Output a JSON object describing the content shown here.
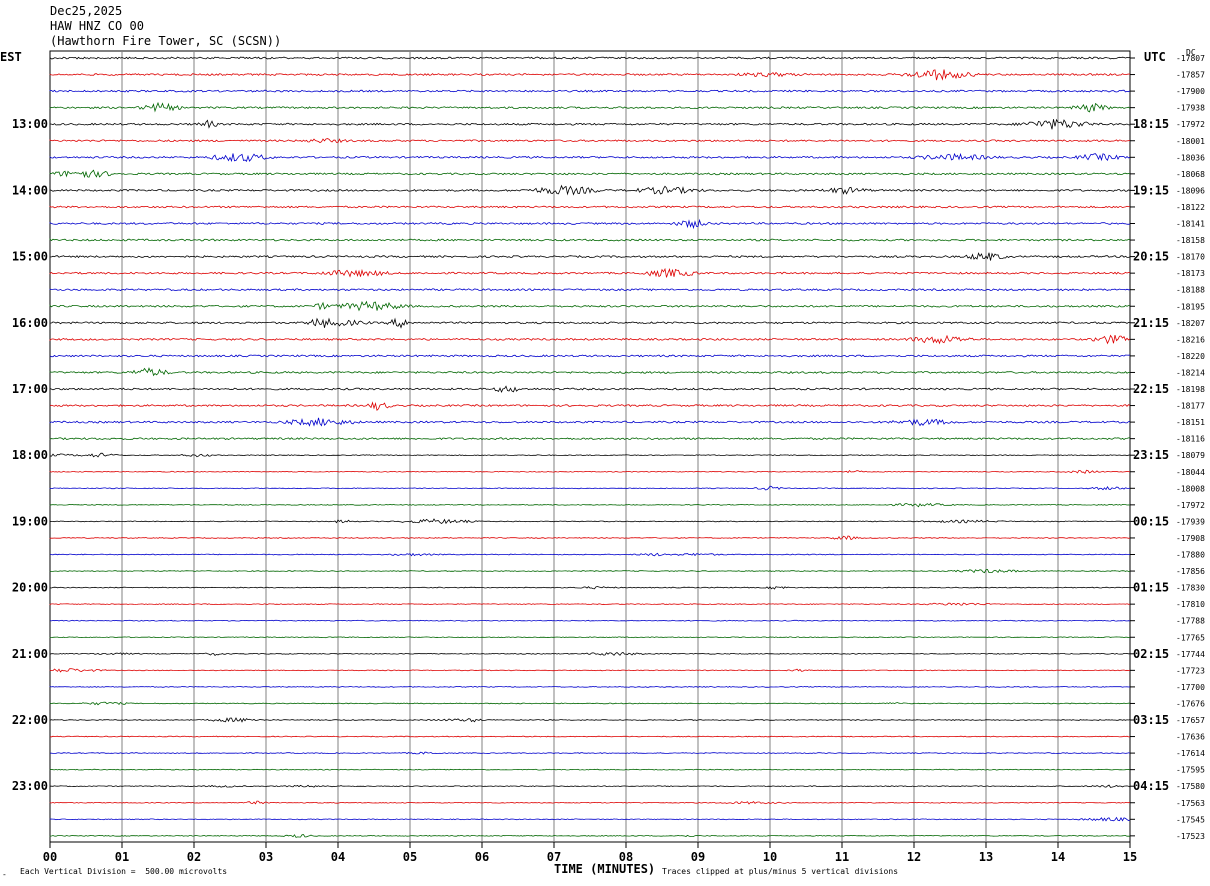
{
  "header": {
    "date": "Dec25,2025",
    "station": "HAW HNZ CO 00",
    "location": "(Hawthorn Fire Tower, SC (SCSN))"
  },
  "left_tz": "EST",
  "right_tz": "UTC",
  "right_unit": "DC",
  "chart_data": {
    "type": "line",
    "title": "",
    "xlabel": "TIME (MINUTES)",
    "x_ticks": [
      "00",
      "01",
      "02",
      "03",
      "04",
      "05",
      "06",
      "07",
      "08",
      "09",
      "10",
      "11",
      "12",
      "13",
      "14",
      "15"
    ],
    "xlim": [
      0,
      15
    ],
    "trace_colors": [
      "#000000",
      "#dd0000",
      "#0000cc",
      "#006600"
    ],
    "left_time_labels": [
      "13:00",
      "14:00",
      "15:00",
      "16:00",
      "17:00",
      "18:00",
      "19:00",
      "20:00",
      "21:00",
      "22:00",
      "23:00"
    ],
    "right_time_labels": [
      "18:15",
      "19:15",
      "20:15",
      "21:15",
      "22:15",
      "23:15",
      "00:15",
      "01:15",
      "02:15",
      "03:15",
      "04:15"
    ],
    "dc_offsets": [
      "-17807",
      "-17857",
      "-17900",
      "-17938",
      "-17972",
      "-18001",
      "-18036",
      "-18068",
      "-18096",
      "-18122",
      "-18141",
      "-18158",
      "-18170",
      "-18173",
      "-18188",
      "-18195",
      "-18207",
      "-18216",
      "-18220",
      "-18214",
      "-18198",
      "-18177",
      "-18151",
      "-18116",
      "-18079",
      "-18044",
      "-18008",
      "-17972",
      "-17939",
      "-17908",
      "-17880",
      "-17856",
      "-17830",
      "-17810",
      "-17788",
      "-17765",
      "-17744",
      "-17723",
      "-17700",
      "-17676",
      "-17657",
      "-17636",
      "-17614",
      "-17595",
      "-17580",
      "-17563",
      "-17545",
      "-17523"
    ]
  },
  "footer": {
    "scale": "Each Vertical Division =  500.00 microvolts",
    "clip": "Traces clipped at plus/minus 5 vertical divisions",
    "corner": "-"
  }
}
